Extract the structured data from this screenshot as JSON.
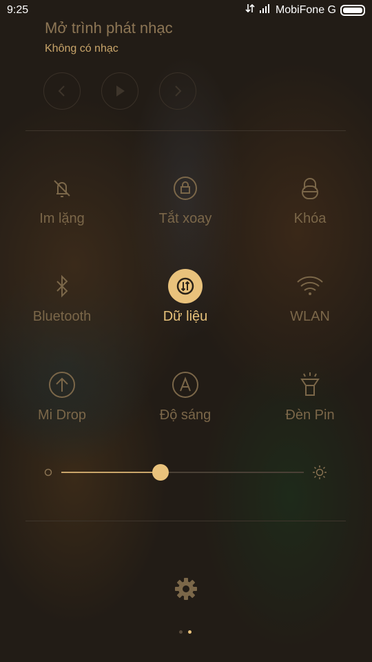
{
  "status": {
    "time": "9:25",
    "carrier": "MobiFone G"
  },
  "music": {
    "title": "Mở trình phát nhạc",
    "subtitle": "Không có nhạc"
  },
  "toggles": [
    {
      "label": "Im lặng",
      "icon": "silent-bell-icon",
      "active": false
    },
    {
      "label": "Tắt xoay",
      "icon": "rotation-lock-icon",
      "active": false
    },
    {
      "label": "Khóa",
      "icon": "lock-icon",
      "active": false
    },
    {
      "label": "Bluetooth",
      "icon": "bluetooth-icon",
      "active": false
    },
    {
      "label": "Dữ liệu",
      "icon": "mobile-data-icon",
      "active": true
    },
    {
      "label": "WLAN",
      "icon": "wifi-icon",
      "active": false
    },
    {
      "label": "Mi Drop",
      "icon": "upload-icon",
      "active": false
    },
    {
      "label": "Độ sáng",
      "icon": "auto-brightness-icon",
      "active": false
    },
    {
      "label": "Đèn Pin",
      "icon": "flashlight-icon",
      "active": false
    }
  ],
  "brightness": {
    "value_percent": 41
  },
  "pager": {
    "pages": 2,
    "current": 2
  },
  "colors": {
    "accent": "#e9c27c",
    "dim": "#7b6749"
  }
}
